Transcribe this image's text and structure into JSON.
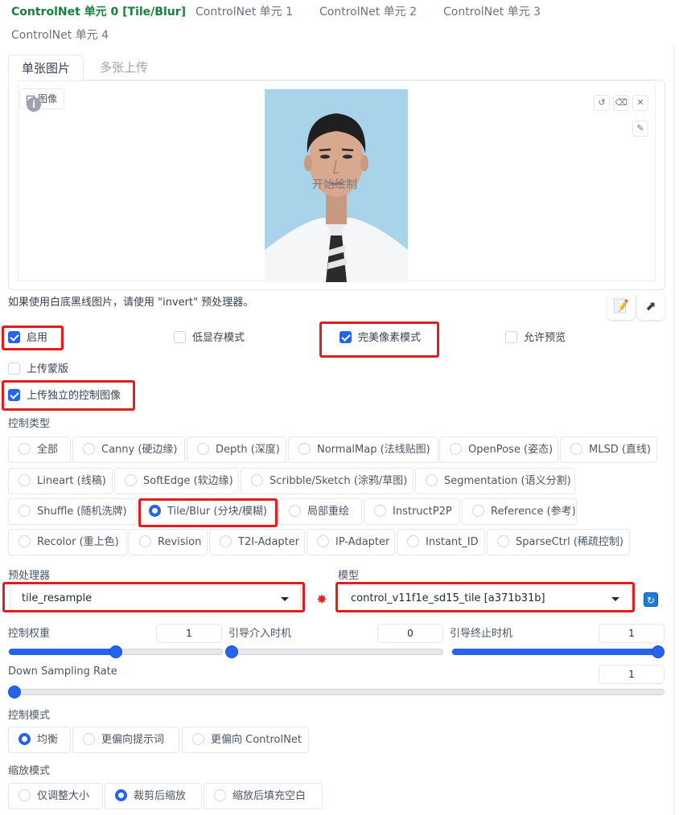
{
  "unit_tabs": [
    {
      "label": "ControlNet 单元 0 [Tile/Blur]",
      "active": true
    },
    {
      "label": "ControlNet 单元 1",
      "active": false
    },
    {
      "label": "ControlNet 单元 2",
      "active": false
    },
    {
      "label": "ControlNet 单元 3",
      "active": false
    },
    {
      "label": "ControlNet 单元 4",
      "active": false
    }
  ],
  "image_tabs": [
    "单张图片",
    "多张上传"
  ],
  "image_panel": {
    "label": "图像",
    "info_glyph": "i",
    "overlay_text": "开始绘制"
  },
  "hint": "如果使用白底黑线图片，请使用 \"invert\" 预处理器。",
  "checkboxes": {
    "enable": {
      "label": "启用",
      "checked": true
    },
    "low_vram": {
      "label": "低显存模式",
      "checked": false
    },
    "pixel_perfect": {
      "label": "完美像素模式",
      "checked": true
    },
    "allow_preview": {
      "label": "允许预览",
      "checked": false
    },
    "upload_mask": {
      "label": "上传蒙版",
      "checked": false
    },
    "upload_independent": {
      "label": "上传独立的控制图像",
      "checked": true
    }
  },
  "control_type": {
    "label": "控制类型",
    "options": [
      "全部",
      "Canny (硬边缘)",
      "Depth (深度)",
      "NormalMap (法线贴图)",
      "OpenPose (姿态)",
      "MLSD (直线)",
      "Lineart (线稿)",
      "SoftEdge (软边缘)",
      "Scribble/Sketch (涂鸦/草图)",
      "Segmentation (语义分割)",
      "Shuffle (随机洗牌)",
      "Tile/Blur (分块/模糊)",
      "局部重绘",
      "InstructP2P",
      "Reference (参考)",
      "Recolor (重上色)",
      "Revision",
      "T2I-Adapter",
      "IP-Adapter",
      "Instant_ID",
      "SparseCtrl (稀疏控制)"
    ],
    "selected": "Tile/Blur (分块/模糊)"
  },
  "preprocessor": {
    "label": "预处理器",
    "value": "tile_resample"
  },
  "model": {
    "label": "模型",
    "value": "control_v11f1e_sd15_tile [a371b31b]"
  },
  "sliders": {
    "control_weight": {
      "label": "控制权重",
      "value": "1",
      "fraction": 0.5
    },
    "start_step": {
      "label": "引导介入时机",
      "value": "0",
      "fraction": 0.0
    },
    "end_step": {
      "label": "引导终止时机",
      "value": "1",
      "fraction": 1.0
    },
    "down_sampling": {
      "label": "Down Sampling Rate",
      "value": "1",
      "fraction": 0.0
    }
  },
  "control_mode": {
    "label": "控制模式",
    "options": [
      "均衡",
      "更偏向提示词",
      "更偏向 ControlNet"
    ],
    "selected": "均衡"
  },
  "resize_mode": {
    "label": "缩放模式",
    "options": [
      "仅调整大小",
      "裁剪后缩放",
      "缩放后填充空白"
    ],
    "selected": "裁剪后缩放"
  },
  "colors": {
    "active_tab": "#15803d",
    "accent": "#2563eb",
    "highlight_box": "#e11d1d",
    "photo_bg": "#a9d3e8"
  }
}
